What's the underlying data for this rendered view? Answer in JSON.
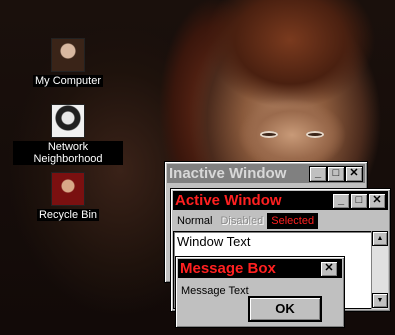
{
  "desktop": {
    "icons": [
      {
        "label": "My Computer"
      },
      {
        "label": "Network Neighborhood"
      },
      {
        "label": "Recycle Bin"
      }
    ]
  },
  "inactive_window": {
    "title": "Inactive Window",
    "buttons": {
      "minimize": "_",
      "maximize": "□",
      "close": "✕"
    }
  },
  "active_window": {
    "title": "Active Window",
    "buttons": {
      "minimize": "_",
      "maximize": "□",
      "close": "✕"
    },
    "menu": {
      "normal": "Normal",
      "disabled": "Disabled",
      "selected": "Selected"
    },
    "content": {
      "text": "Window Text"
    }
  },
  "message_box": {
    "title": "Message Box",
    "close": "✕",
    "text": "Message Text",
    "ok_label": "OK"
  },
  "colors": {
    "active_title_bg": "#000000",
    "active_title_text": "#ff2020",
    "inactive_title_bg": "#808080",
    "inactive_title_text": "#d8d8d8",
    "window_face": "#c0c0c0"
  }
}
